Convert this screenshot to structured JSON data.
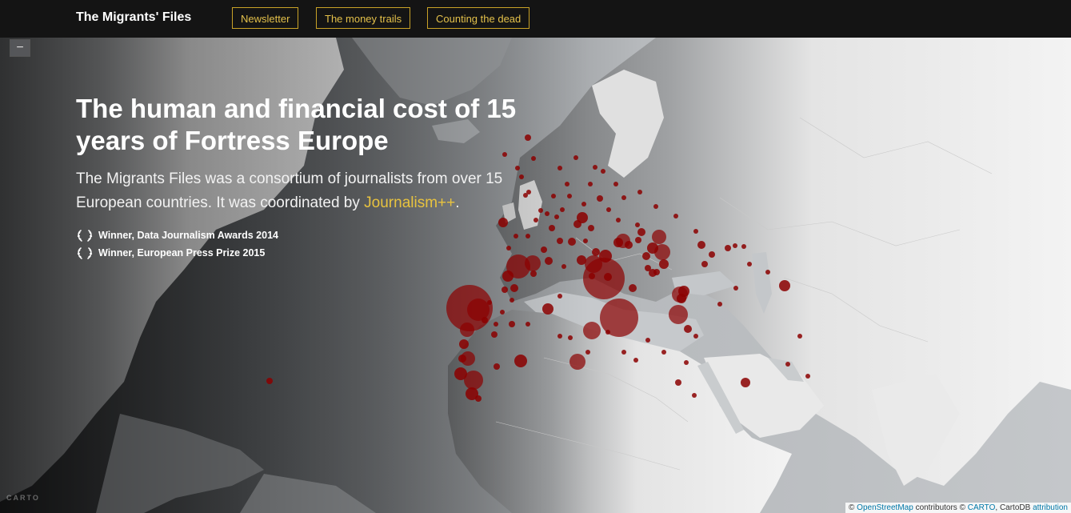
{
  "nav": {
    "brand": "The Migrants' Files",
    "items": [
      {
        "label": "Newsletter"
      },
      {
        "label": "The money trails"
      },
      {
        "label": "Counting the dead"
      }
    ]
  },
  "hero": {
    "headline_line1": "The human and financial cost of 15",
    "headline_line2": "years of Fortress Europe",
    "subtitle_line1": "The Migrants Files was a consortium of journalists from over 15",
    "subtitle_line2_pre": "European countries. It was coordinated by",
    "subtitle_link": "Journalism++",
    "subtitle_end": "."
  },
  "awards": [
    {
      "label": "Winner, Data Journalism Awards 2014",
      "icon": "laurel-wreath-icon"
    },
    {
      "label": "Winner, European Press Prize 2015",
      "icon": "laurel-wreath-icon"
    }
  ],
  "map": {
    "zoom_out_label": "−",
    "carto_logo": "CARTO",
    "attribution": {
      "prefix": "©",
      "osm": "OpenStreetMap",
      "mid": "contributors ©",
      "carto": "CARTO",
      "cartodb": ", CartoDB",
      "attribution_link": "attribution"
    },
    "marker_color": "#8b0000"
  },
  "colors": {
    "topbar": "#141414",
    "accent": "#e3c04a",
    "ocean_dark": "#2e3032",
    "land": "#eeeeee"
  }
}
